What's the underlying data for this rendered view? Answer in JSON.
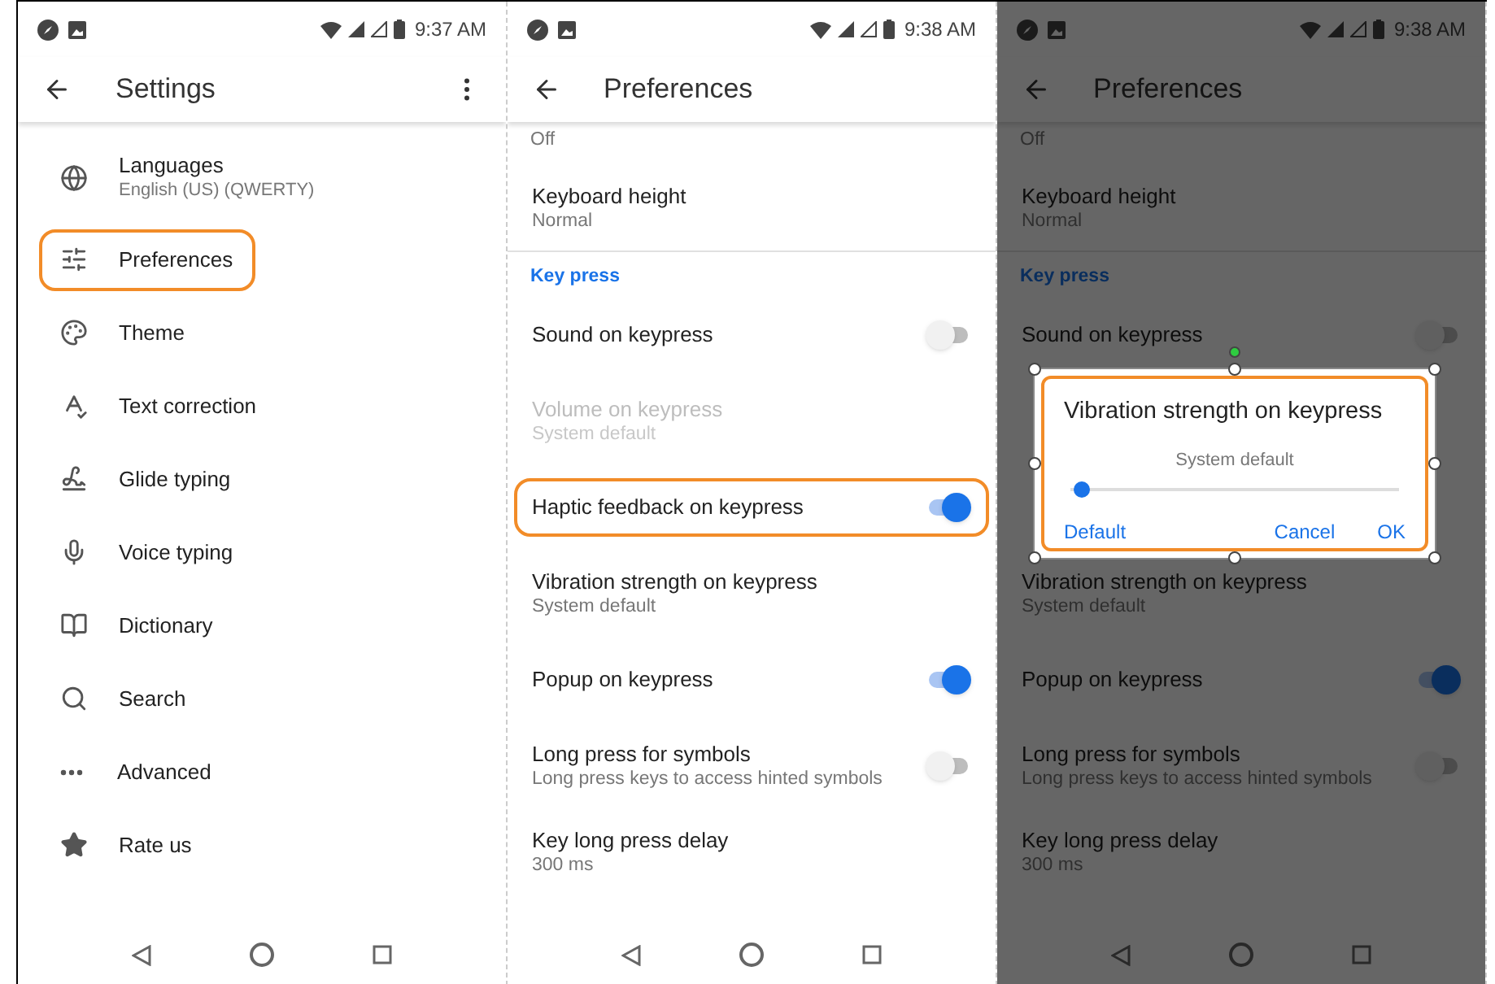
{
  "screens": [
    {
      "kind": "settings",
      "dimmed": false,
      "status_bar": {
        "time": "9:37 AM"
      },
      "title": "Settings",
      "items": [
        {
          "label": "Languages",
          "sublabel": "English (US) (QWERTY)",
          "highlighted": false
        },
        {
          "label": "Preferences",
          "highlighted": true
        },
        {
          "label": "Theme",
          "highlighted": false
        },
        {
          "label": "Text correction",
          "highlighted": false
        },
        {
          "label": "Glide typing",
          "highlighted": false
        },
        {
          "label": "Voice typing",
          "highlighted": false
        },
        {
          "label": "Dictionary",
          "highlighted": false
        },
        {
          "label": "Search",
          "highlighted": false
        },
        {
          "label": "Advanced",
          "highlighted": false
        },
        {
          "label": "Rate us",
          "highlighted": false
        }
      ]
    },
    {
      "kind": "preferences",
      "dimmed": false,
      "status_bar": {
        "time": "9:38 AM"
      },
      "title": "Preferences",
      "rows": [
        {
          "kind": "partial",
          "subtitle": "Off"
        },
        {
          "kind": "item",
          "title": "Keyboard height",
          "subtitle": "Normal",
          "disabled": false,
          "highlighted": false
        },
        {
          "kind": "header",
          "title": "Key press"
        },
        {
          "kind": "switch",
          "title": "Sound on keypress",
          "on": false,
          "disabled": false,
          "highlighted": false
        },
        {
          "kind": "item",
          "title": "Volume on keypress",
          "subtitle": "System default",
          "disabled": true,
          "highlighted": false
        },
        {
          "kind": "switch",
          "title": "Haptic feedback on keypress",
          "on": true,
          "disabled": false,
          "highlighted": true
        },
        {
          "kind": "item",
          "title": "Vibration strength on keypress",
          "subtitle": "System default",
          "disabled": false,
          "highlighted": false
        },
        {
          "kind": "switch",
          "title": "Popup on keypress",
          "on": true,
          "disabled": false,
          "highlighted": false
        },
        {
          "kind": "switch",
          "title": "Long press for symbols",
          "subtitle": "Long press keys to access hinted symbols",
          "on": false,
          "disabled": false,
          "highlighted": false
        },
        {
          "kind": "item",
          "title": "Key long press delay",
          "subtitle": "300 ms",
          "disabled": false,
          "highlighted": false
        }
      ]
    },
    {
      "kind": "preferences",
      "dimmed": true,
      "status_bar": {
        "time": "9:38 AM"
      },
      "title": "Preferences",
      "rows": [
        {
          "kind": "partial",
          "subtitle": "Off"
        },
        {
          "kind": "item",
          "title": "Keyboard height",
          "subtitle": "Normal",
          "disabled": false,
          "highlighted": false
        },
        {
          "kind": "header",
          "title": "Key press"
        },
        {
          "kind": "switch",
          "title": "Sound on keypress",
          "on": false,
          "disabled": false,
          "highlighted": false
        },
        {
          "kind": "dialog",
          "title": "Vibration strength on keypress",
          "reading": "System default",
          "level": 0.02,
          "buttons": [
            "Default",
            "Cancel",
            "OK"
          ],
          "highlighted": true
        },
        {
          "kind": "item",
          "title": "Vibration strength on keypress",
          "subtitle": "System default",
          "disabled": false,
          "highlighted": false
        },
        {
          "kind": "switch",
          "title": "Popup on keypress",
          "on": true,
          "disabled": false,
          "highlighted": false
        },
        {
          "kind": "switch",
          "title": "Long press for symbols",
          "subtitle": "Long press keys to access hinted symbols",
          "on": false,
          "disabled": false,
          "highlighted": false
        },
        {
          "kind": "item",
          "title": "Key long press delay",
          "subtitle": "300 ms",
          "disabled": false,
          "highlighted": false
        }
      ]
    }
  ]
}
